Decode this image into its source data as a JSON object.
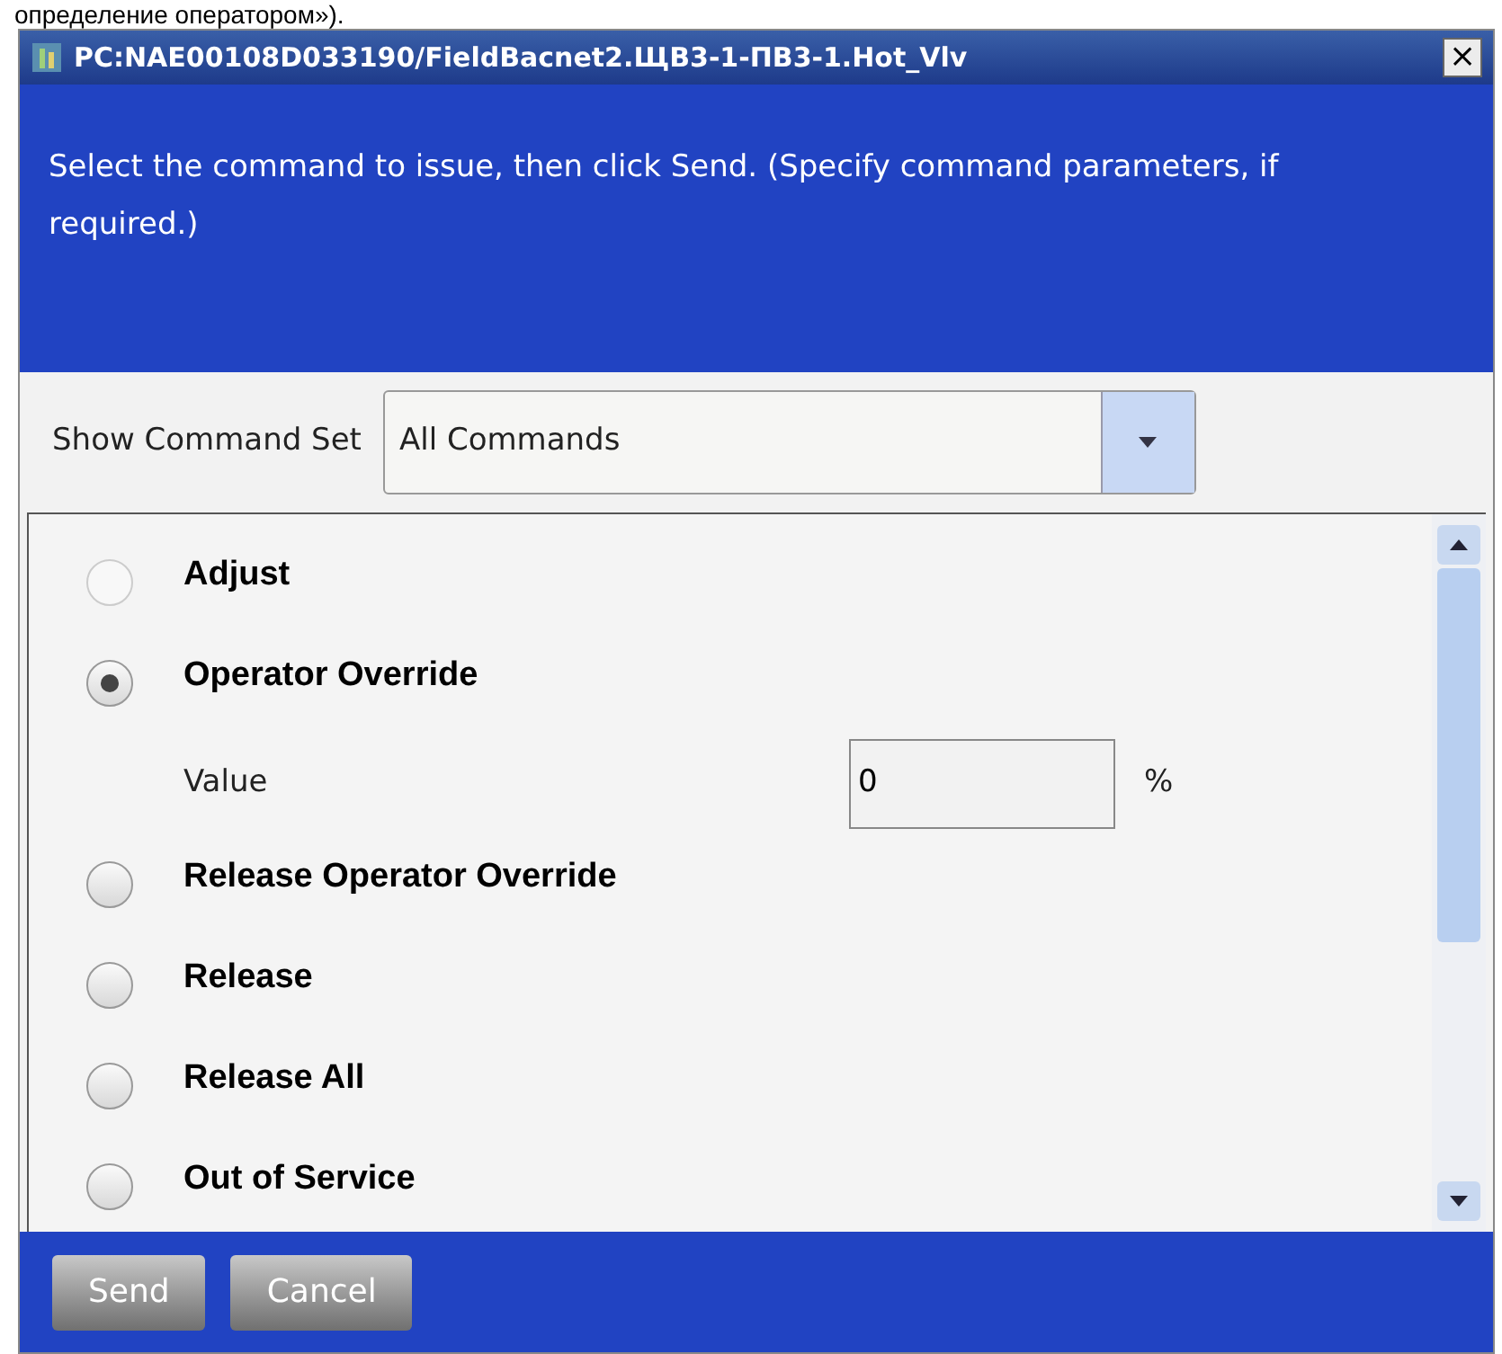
{
  "background_text": "определение оператором»).",
  "window": {
    "title": "PC:NAE00108D033190/FieldBacnet2.ЩВ3-1-ПВ3-1.Hot_Vlv",
    "close": "×"
  },
  "instructions": "Select the command to issue, then click Send. (Specify command parameters, if required.)",
  "command_set": {
    "label": "Show Command Set",
    "value": "All Commands"
  },
  "commands": [
    {
      "label": "Adjust",
      "selected": false,
      "disabled": true
    },
    {
      "label": "Operator Override",
      "selected": true,
      "disabled": false,
      "parameter": {
        "label": "Value",
        "value": "0",
        "unit": "%"
      }
    },
    {
      "label": "Release Operator Override",
      "selected": false,
      "disabled": false
    },
    {
      "label": "Release",
      "selected": false,
      "disabled": false
    },
    {
      "label": "Release All",
      "selected": false,
      "disabled": false
    },
    {
      "label": "Out of Service",
      "selected": false,
      "disabled": false
    }
  ],
  "buttons": [
    {
      "label": "Send"
    },
    {
      "label": "Cancel"
    }
  ]
}
